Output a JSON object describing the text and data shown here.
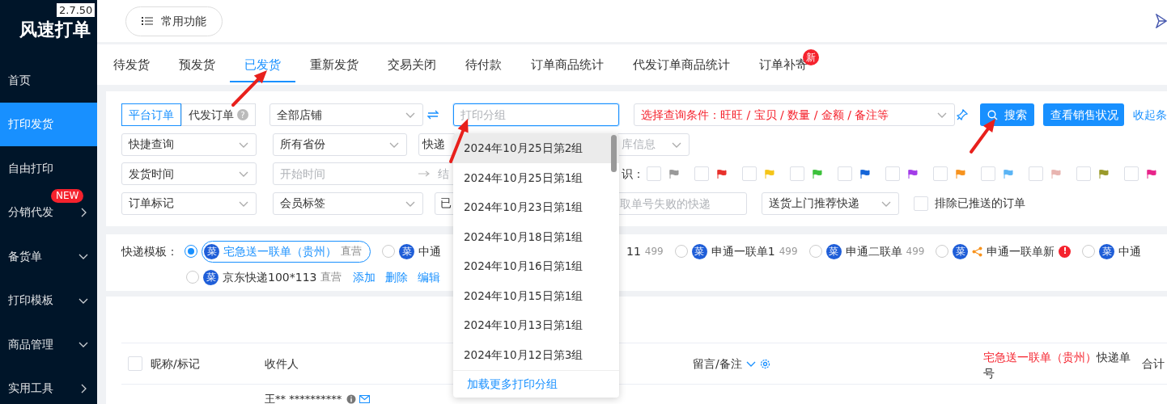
{
  "app": {
    "logo": "风速打单",
    "version": "2.7.50"
  },
  "sidebar": {
    "items": [
      {
        "label": "首页",
        "selected": false
      },
      {
        "label": "打印发货",
        "selected": true
      },
      {
        "label": "自由打印",
        "selected": false
      },
      {
        "label": "分销代发",
        "selected": false,
        "badge": "NEW",
        "kind": "flyout"
      },
      {
        "label": "备货单",
        "selected": false,
        "kind": "submenu"
      },
      {
        "label": "打印模板",
        "selected": false,
        "kind": "submenu"
      },
      {
        "label": "商品管理",
        "selected": false,
        "kind": "submenu"
      },
      {
        "label": "实用工具",
        "selected": false,
        "kind": "flyout"
      }
    ]
  },
  "header": {
    "quick_button": "常用功能"
  },
  "tabs": [
    {
      "label": "待发货",
      "selected": false
    },
    {
      "label": "预发货",
      "selected": false
    },
    {
      "label": "已发货",
      "selected": true
    },
    {
      "label": "重新发货",
      "selected": false
    },
    {
      "label": "交易关闭",
      "selected": false
    },
    {
      "label": "待付款",
      "selected": false
    },
    {
      "label": "订单商品统计",
      "selected": false
    },
    {
      "label": "代发订单商品统计",
      "selected": false
    },
    {
      "label": "订单补寄",
      "selected": false,
      "badge": "新"
    }
  ],
  "filters": {
    "rows": [
      {
        "controls": [
          {
            "kind": "segmented",
            "options": [
              {
                "label": "平台订单",
                "selected": true
              },
              {
                "label": "代发订单",
                "selected": false,
                "help": "?"
              }
            ]
          },
          {
            "kind": "select",
            "value": "全部店铺"
          },
          {
            "kind": "swap"
          },
          {
            "kind": "input",
            "placeholder": "打印分组",
            "focused": true
          },
          {
            "kind": "condition",
            "value": "选择查询条件：旺旺 / 宝贝 / 数量 / 金额 / 备注等"
          },
          {
            "kind": "pin"
          },
          {
            "kind": "search_button",
            "label": "搜索"
          },
          {
            "kind": "button",
            "label": "查看销售状况"
          },
          {
            "kind": "link",
            "label": "收起条"
          }
        ]
      },
      {
        "controls": [
          {
            "kind": "select",
            "value": "快捷查询"
          },
          {
            "kind": "select",
            "value": "所有省份"
          },
          {
            "kind": "select",
            "value": "快递"
          },
          {
            "kind": "select",
            "placeholder": "库信息"
          }
        ]
      },
      {
        "controls": [
          {
            "kind": "select",
            "value": "发货时间"
          },
          {
            "kind": "daterange",
            "start_placeholder": "开始时间",
            "end_placeholder": "结"
          },
          {
            "kind": "label",
            "label": "识："
          },
          {
            "kind": "flag",
            "checked": false,
            "color": "#999999"
          },
          {
            "kind": "flag",
            "checked": false,
            "color": "#e8312b"
          },
          {
            "kind": "flag",
            "checked": false,
            "color": "#f5c518"
          },
          {
            "kind": "flag",
            "checked": false,
            "color": "#3cc13b"
          },
          {
            "kind": "flag",
            "checked": false,
            "color": "#1565d8"
          },
          {
            "kind": "flag",
            "checked": false,
            "color": "#a23ce8"
          },
          {
            "kind": "flag",
            "checked": false,
            "color": "#f7931e"
          },
          {
            "kind": "flag",
            "checked": false,
            "color": "#5ab4f5"
          },
          {
            "kind": "flag",
            "checked": false,
            "color": "#e8b4b0"
          },
          {
            "kind": "flag",
            "checked": false,
            "color": "#9a9a2a"
          },
          {
            "kind": "flag",
            "checked": false,
            "color": "#e8248a"
          }
        ]
      },
      {
        "controls": [
          {
            "kind": "select",
            "value": "订单标记"
          },
          {
            "kind": "select",
            "value": "会员标签"
          },
          {
            "kind": "select",
            "value": "已"
          },
          {
            "kind": "input",
            "placeholder": "取单号失败的快递",
            "focused": false
          },
          {
            "kind": "select",
            "value": "送货上门推荐快递"
          },
          {
            "kind": "checkbox",
            "label": "排除已推送的订单",
            "checked": false
          }
        ]
      }
    ]
  },
  "templates": {
    "label": "快递模板：",
    "rows": [
      [
        {
          "selected": true,
          "logo": "菜",
          "name": "宅急送一联单（贵州）",
          "tag": "直营"
        },
        {
          "selected": false,
          "logo": "菜",
          "name": "中通",
          "tail": "11",
          "count": "499"
        },
        {
          "selected": false,
          "logo": "菜",
          "name": "申通一联单1",
          "count": "499"
        },
        {
          "selected": false,
          "logo": "菜",
          "name": "申通二联单",
          "count": "499"
        },
        {
          "selected": false,
          "logo": "菜",
          "shared": true,
          "name": "申通一联单新",
          "warning": "!"
        },
        {
          "selected": false,
          "logo": "菜",
          "name": "中通"
        }
      ],
      [
        {
          "selected": false,
          "logo": "菜",
          "name": "京东快递100*113",
          "tag": "直营"
        }
      ]
    ],
    "actions": [
      "添加",
      "删除",
      "编辑"
    ]
  },
  "table": {
    "columns": [
      {
        "kind": "check",
        "label": "昵称/标记",
        "checked": false
      },
      {
        "kind": "plain",
        "label": "收件人"
      },
      {
        "kind": "menu",
        "label": "留言/备注"
      },
      {
        "kind": "prefixed",
        "prefix": "宅急送一联单（贵州）",
        "label": "快递单号"
      },
      {
        "kind": "plain",
        "label": "合计"
      }
    ],
    "rows": [
      {
        "receiver": "王** **********"
      }
    ]
  },
  "print_group_dropdown": {
    "options": [
      {
        "label": "2024年10月25日第2组",
        "hovered": true
      },
      {
        "label": "2024年10月25日第1组",
        "hovered": false
      },
      {
        "label": "2024年10月23日第1组",
        "hovered": false
      },
      {
        "label": "2024年10月18日第1组",
        "hovered": false
      },
      {
        "label": "2024年10月16日第1组",
        "hovered": false
      },
      {
        "label": "2024年10月15日第1组",
        "hovered": false
      },
      {
        "label": "2024年10月13日第1组",
        "hovered": false
      },
      {
        "label": "2024年10月12日第3组",
        "hovered": false
      }
    ],
    "footer": "加载更多打印分组"
  }
}
